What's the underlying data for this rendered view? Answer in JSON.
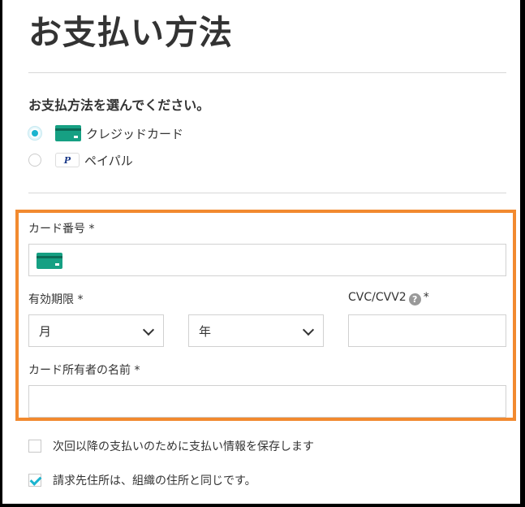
{
  "page": {
    "title": "お支払い方法"
  },
  "payment_method": {
    "heading": "お支払方法を選んでください。",
    "options": [
      {
        "label": "クレジッドカード",
        "icon": "credit-card-icon",
        "selected": true
      },
      {
        "label": "ペイパル",
        "icon": "paypal-icon",
        "icon_text": "P",
        "selected": false
      }
    ]
  },
  "card_form": {
    "card_number": {
      "label": "カード番号 *",
      "value": "",
      "icon": "credit-card-icon"
    },
    "expiry": {
      "label": "有効期限 *",
      "month_value": "月",
      "year_value": "年"
    },
    "cvc": {
      "label": "CVC/CVV2",
      "required_mark": "*",
      "help_icon_text": "?",
      "value": ""
    },
    "holder_name": {
      "label": "カード所有者の名前 *",
      "value": ""
    }
  },
  "options": {
    "save_info": {
      "label": "次回以降の支払いのために支払い情報を保存します",
      "checked": false
    },
    "same_address": {
      "label": "請求先住所は、組織の住所と同じです。",
      "checked": true
    }
  },
  "colors": {
    "accent": "#1bb4cf",
    "highlight_border": "#f28a2f",
    "card_green": "#16a083"
  }
}
